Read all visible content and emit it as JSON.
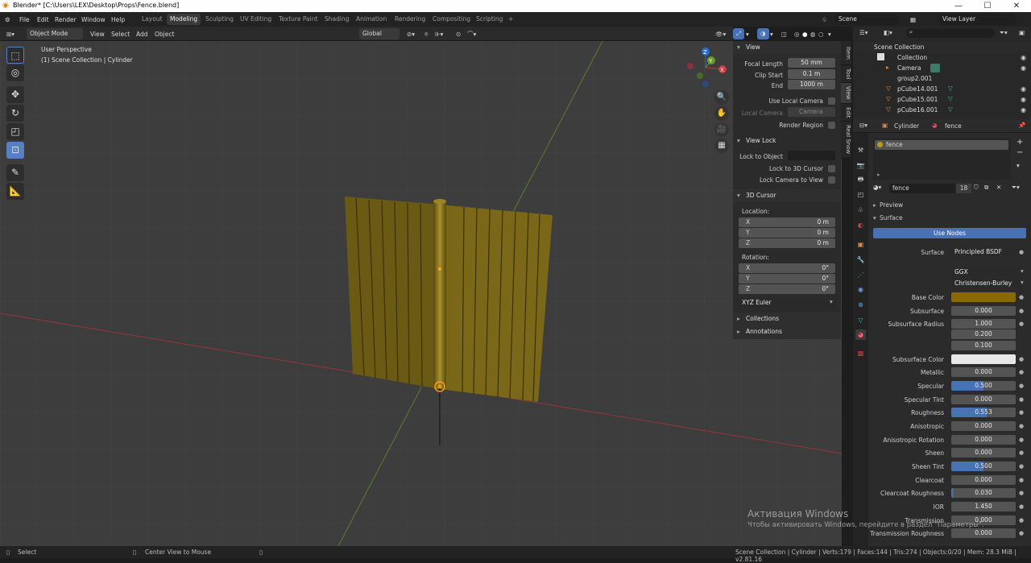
{
  "window": {
    "title": "Blender* [C:\\Users\\LEX\\Desktop\\Props\\Fence.blend]",
    "minimize": "—",
    "maximize": "☐",
    "close": "✕"
  },
  "menu": [
    "File",
    "Edit",
    "Render",
    "Window",
    "Help"
  ],
  "workspaces": [
    "Layout",
    "Modeling",
    "Sculpting",
    "UV Editing",
    "Texture Paint",
    "Shading",
    "Animation",
    "Rendering",
    "Compositing",
    "Scripting",
    "+"
  ],
  "active_workspace": "Modeling",
  "scene": "Scene",
  "view_layer": "View Layer",
  "viewport_header": {
    "mode": "Object Mode",
    "view": "View",
    "select": "Select",
    "add": "Add",
    "object": "Object",
    "orientation": "Global"
  },
  "viewport": {
    "perspective": "User Perspective",
    "collection_info": "(1) Scene Collection | Cylinder",
    "axes": {
      "x": "X",
      "y": "Y",
      "z": "Z"
    }
  },
  "npanel": {
    "tabs": [
      "Item",
      "Tool",
      "View",
      "Edit",
      "Real Snow"
    ],
    "view": {
      "header": "View",
      "focal_label": "Focal Length",
      "focal": "50 mm",
      "clip_start_label": "Clip Start",
      "clip_start": "0.1 m",
      "end_label": "End",
      "end": "1000 m",
      "use_local_camera": "Use Local Camera",
      "local_camera_label": "Local Camera",
      "local_camera": "Camera",
      "render_region": "Render Region"
    },
    "view_lock": {
      "header": "View Lock",
      "lock_to_object": "Lock to Object",
      "lock_3d_cursor": "Lock to 3D Cursor",
      "lock_camera": "Lock Camera to View"
    },
    "cursor": {
      "header": "3D Cursor",
      "location": "Location:",
      "rotation": "Rotation:",
      "lx": "X",
      "ly": "Y",
      "lz": "Z",
      "loc_x": "0 m",
      "loc_y": "0 m",
      "loc_z": "0 m",
      "rot_x": "0°",
      "rot_y": "0°",
      "rot_z": "0°",
      "euler": "XYZ Euler"
    },
    "collections": "Collections",
    "annotations": "Annotations"
  },
  "outliner": {
    "root": "Scene Collection",
    "rows": [
      "Collection",
      "Camera",
      "group2.001",
      "pCube14.001",
      "pCube15.001",
      "pCube16.001"
    ]
  },
  "properties": {
    "object": "Cylinder",
    "material": "fence",
    "slot": "fence",
    "users": "18",
    "preview": "Preview",
    "surface_header": "Surface",
    "use_nodes": "Use Nodes",
    "surface_label": "Surface",
    "surface_shader": "Principled BSDF",
    "distribution": "GGX",
    "subsurface_method": "Christensen-Burley",
    "base_color_hex": "#8a6a00",
    "subsurface_color_hex": "#e8e8e8",
    "params": [
      {
        "label": "Base Color",
        "value": ""
      },
      {
        "label": "Subsurface",
        "value": "0.000"
      },
      {
        "label": "Subsurface Radius",
        "value": "1.000"
      },
      {
        "label": "",
        "value": "0.200"
      },
      {
        "label": "",
        "value": "0.100"
      },
      {
        "label": "Subsurface Color",
        "value": ""
      },
      {
        "label": "Metallic",
        "value": "0.000"
      },
      {
        "label": "Specular",
        "value": "0.500",
        "fill": 0.5
      },
      {
        "label": "Specular Tint",
        "value": "0.000"
      },
      {
        "label": "Roughness",
        "value": "0.553",
        "fill": 0.553
      },
      {
        "label": "Anisotropic",
        "value": "0.000"
      },
      {
        "label": "Anisotropic Rotation",
        "value": "0.000"
      },
      {
        "label": "Sheen",
        "value": "0.000"
      },
      {
        "label": "Sheen Tint",
        "value": "0.500",
        "fill": 0.5
      },
      {
        "label": "Clearcoat",
        "value": "0.000"
      },
      {
        "label": "Clearcoat Roughness",
        "value": "0.030",
        "fill": 0.03
      },
      {
        "label": "IOR",
        "value": "1.450"
      },
      {
        "label": "Transmission",
        "value": "0.000"
      },
      {
        "label": "Transmission Roughness",
        "value": "0.000"
      }
    ]
  },
  "status": {
    "select": "Select",
    "center": "Center View to Mouse",
    "stats": "Scene Collection | Cylinder | Verts:179 | Faces:144 | Tris:274 | Objects:0/20 | Mem: 28.3 MiB | v2.81.16"
  },
  "watermark": {
    "title": "Активация Windows",
    "sub": "Чтобы активировать Windows, перейдите в раздел \"Параметры\"."
  }
}
